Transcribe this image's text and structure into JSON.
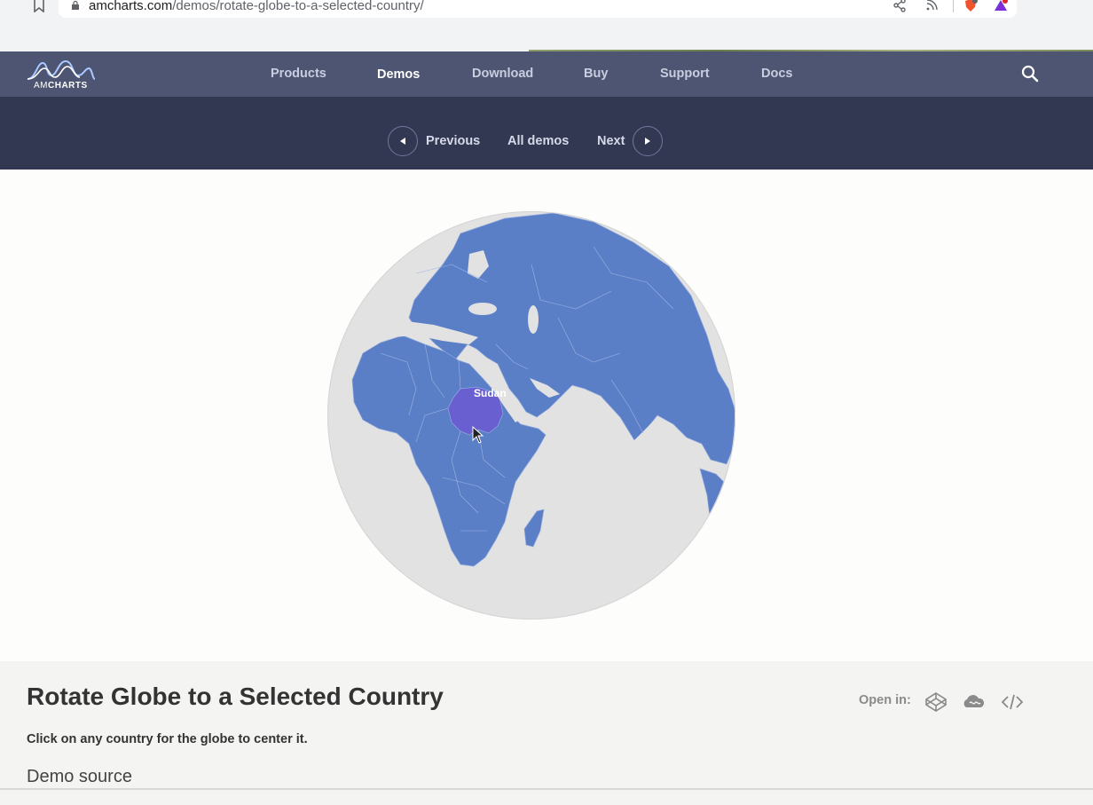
{
  "browser": {
    "url_host": "amcharts.com",
    "url_path": "/demos/rotate-globe-to-a-selected-country/"
  },
  "header": {
    "logo_text_light": "AM",
    "logo_text_bold": "CHARTS",
    "nav": [
      {
        "label": "Products"
      },
      {
        "label": "Demos",
        "active": true
      },
      {
        "label": "Download"
      },
      {
        "label": "Buy"
      },
      {
        "label": "Support"
      },
      {
        "label": "Docs"
      }
    ]
  },
  "demo_nav": {
    "previous_label": "Previous",
    "all_label": "All demos",
    "next_label": "Next"
  },
  "globe": {
    "highlighted_country": "Sudan",
    "land_color": "#5b7fc7",
    "water_color": "#e2e2e2",
    "highlight_color": "#6a5fd1"
  },
  "info": {
    "title": "Rotate Globe to a Selected Country",
    "open_in_label": "Open in:",
    "open_in_icons": [
      "codepen-icon",
      "jsfiddle-icon",
      "code-icon"
    ],
    "description": "Click on any country for the globe to center it.",
    "source_heading": "Demo source"
  },
  "colors": {
    "header_bg": "#4d5572",
    "demo_nav_bg": "#323851",
    "accent": "#6f79a0"
  }
}
